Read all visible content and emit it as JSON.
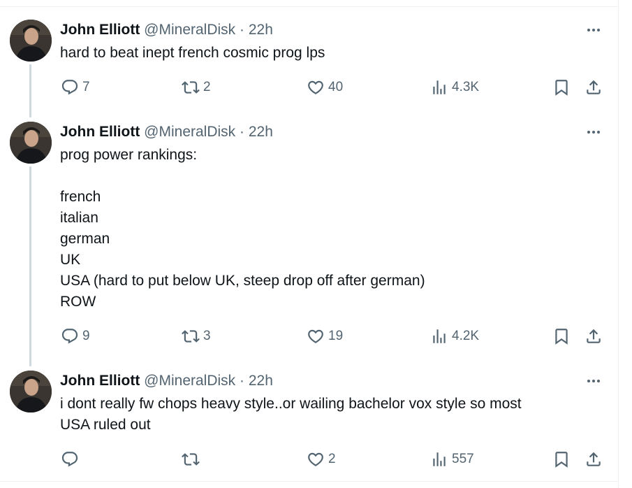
{
  "tweets": [
    {
      "name": "John Elliott",
      "handle": "@MineralDisk",
      "separator": "·",
      "time": "22h",
      "text": "hard to beat inept french cosmic prog lps",
      "replies": "7",
      "retweets": "2",
      "likes": "40",
      "views": "4.3K"
    },
    {
      "name": "John Elliott",
      "handle": "@MineralDisk",
      "separator": "·",
      "time": "22h",
      "text": "prog power rankings:\n\nfrench\nitalian\ngerman\nUK\nUSA (hard to put below UK, steep drop off after german)\nROW",
      "replies": "9",
      "retweets": "3",
      "likes": "19",
      "views": "4.2K"
    },
    {
      "name": "John Elliott",
      "handle": "@MineralDisk",
      "separator": "·",
      "time": "22h",
      "text": "i dont really fw chops heavy style..or wailing bachelor vox style so most\nUSA ruled out",
      "replies": "",
      "retweets": "",
      "likes": "2",
      "views": "557"
    }
  ],
  "icons": {
    "reply": "reply-icon",
    "retweet": "retweet-icon",
    "like": "heart-icon",
    "views": "views-icon",
    "bookmark": "bookmark-icon",
    "share": "share-icon",
    "more": "more-icon"
  },
  "colors": {
    "text": "#0f1419",
    "secondary": "#536471",
    "thread_line": "#cfd9de",
    "divider": "#eff3f4"
  }
}
